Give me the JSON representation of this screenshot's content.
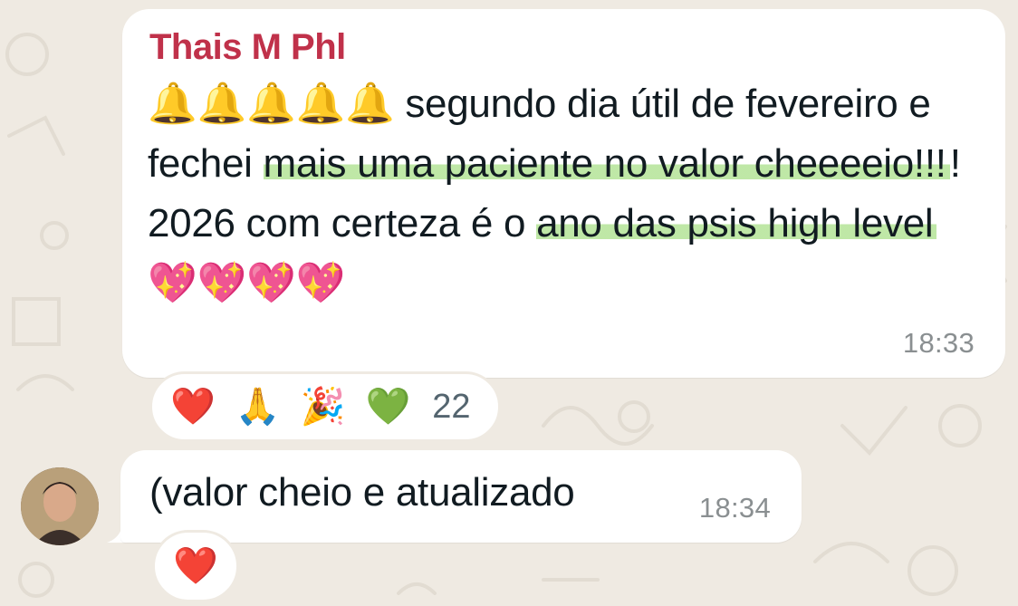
{
  "messages": [
    {
      "sender": "Thais M Phl",
      "sender_color": "#c0314a",
      "text_parts": [
        {
          "text": "🔔🔔🔔🔔🔔 segundo dia útil de fevereiro e fechei ",
          "highlight": false
        },
        {
          "text": "mais uma paciente no valor cheeeeio!!!",
          "highlight": true
        },
        {
          "text": "! 2026 com certeza é o ",
          "highlight": false
        },
        {
          "text": "ano das psis high level ",
          "highlight": true
        },
        {
          "text": "💖💖💖💖",
          "highlight": false
        }
      ],
      "time": "18:33",
      "reactions": {
        "emojis": [
          "❤️",
          "🙏",
          "🎉",
          "💚"
        ],
        "count": "22"
      }
    },
    {
      "text": "(valor cheio e atualizado",
      "time": "18:34",
      "reactions": {
        "emojis": [
          "❤️"
        ]
      }
    }
  ],
  "colors": {
    "background": "#efeae2",
    "bubble": "#ffffff",
    "highlight": "#8ad45e",
    "timestamp": "#8a8f91"
  }
}
